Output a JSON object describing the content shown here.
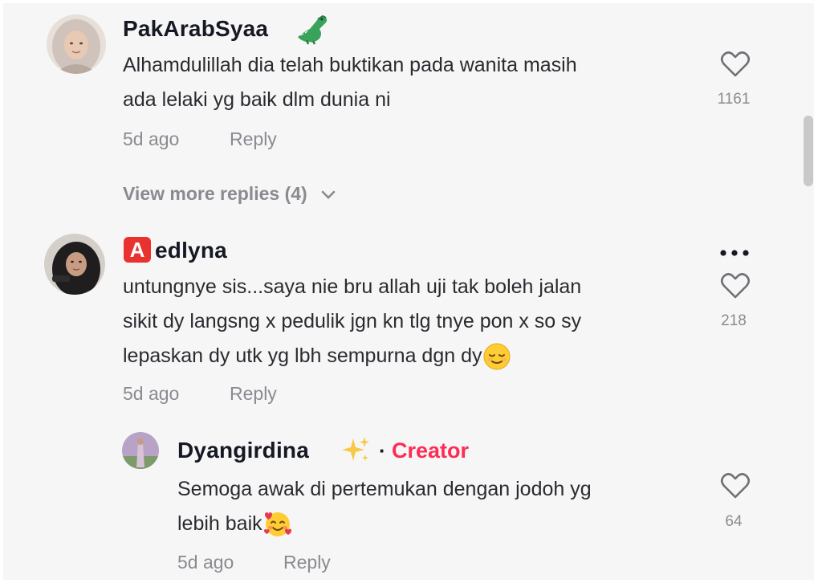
{
  "comments": [
    {
      "username": "PakArabSyaa",
      "username_emoji": "crocodile-emoji",
      "lines": [
        "Alhamdulillah dia telah buktikan pada wanita masih",
        "ada lelaki yg baik dlm dunia ni"
      ],
      "time": "5d ago",
      "reply_label": "Reply",
      "likes": "1161",
      "view_more": "View more replies (4)"
    },
    {
      "username_badge": "A",
      "username": "edlyna",
      "lines": [
        "untungnye sis...saya nie bru allah uji tak boleh jalan",
        "sikit dy langsng x pedulik jgn kn tlg tnye pon x so sy",
        "lepaskan dy utk yg lbh sempurna dgn dy"
      ],
      "trailing_emoji": "relieved-face-emoji",
      "time": "5d ago",
      "reply_label": "Reply",
      "likes": "218"
    }
  ],
  "reply": {
    "username": "Dyangirdina",
    "username_emoji": "sparkles-emoji",
    "separator": "·",
    "creator_label": "Creator",
    "lines": [
      "Semoga awak di pertemukan dengan jodoh yg",
      "lebih baik"
    ],
    "trailing_emoji": "smiling-face-with-hearts-emoji",
    "time": "5d ago",
    "reply_label": "Reply",
    "likes": "64"
  },
  "colors": {
    "background": "#f6f6f6",
    "text_primary": "#161823",
    "text_secondary": "#8a8b91",
    "creator_accent": "#fe2c55",
    "badge_red": "#e8322f"
  }
}
